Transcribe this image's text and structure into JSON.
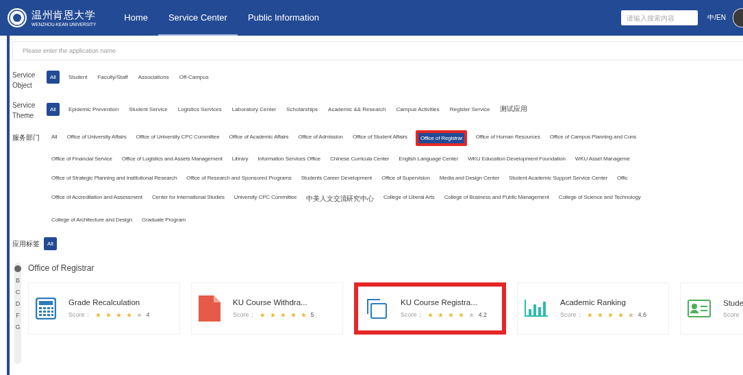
{
  "header": {
    "logo_name": "温州肯恩大学",
    "logo_subtitle": "WENZHOU-KEAN UNIVERSITY",
    "nav": [
      {
        "label": "Home",
        "selected": false
      },
      {
        "label": "Service Center",
        "selected": true
      },
      {
        "label": "Public Information",
        "selected": false
      }
    ],
    "search": {
      "placeholder": "请输入搜索内容"
    },
    "language": "中/EN"
  },
  "app_search": {
    "placeholder": "Please enter the application name"
  },
  "filters": [
    {
      "label": "Service Object",
      "options": [
        {
          "label": "All",
          "selected": true
        },
        {
          "label": "Student",
          "selected": false
        },
        {
          "label": "Faculty/Staff",
          "selected": false
        },
        {
          "label": "Associations",
          "selected": false
        },
        {
          "label": "Off-Campus",
          "selected": false
        }
      ]
    },
    {
      "label": "Service Theme",
      "options": [
        {
          "label": "All",
          "selected": true
        },
        {
          "label": "Epidemic Prevention",
          "selected": false
        },
        {
          "label": "Student Service",
          "selected": false
        },
        {
          "label": "Logistics Services",
          "selected": false
        },
        {
          "label": "Laboratory Center",
          "selected": false
        },
        {
          "label": "Scholarships",
          "selected": false
        },
        {
          "label": "Academic && Research",
          "selected": false
        },
        {
          "label": "Campus Activities",
          "selected": false
        },
        {
          "label": "Register Service",
          "selected": false
        },
        {
          "label": "测试应用",
          "selected": false
        }
      ]
    }
  ],
  "departments": {
    "label": "服务部门",
    "lines": [
      {
        "items": [
          {
            "label": "All",
            "selected": false,
            "highlighted": false
          },
          {
            "label": "Office of University Affairs",
            "selected": false,
            "highlighted": false
          },
          {
            "label": "Office of University CPC Committee",
            "selected": false,
            "highlighted": false
          },
          {
            "label": "Office of Academic Affairs",
            "selected": false,
            "highlighted": false
          },
          {
            "label": "Office of Admission",
            "selected": false,
            "highlighted": false
          },
          {
            "label": "Office of Student Affairs",
            "selected": false,
            "highlighted": false
          },
          {
            "label": "Office of Registrar",
            "selected": true,
            "highlighted": true
          },
          {
            "label": "Office of Human Resources",
            "selected": false,
            "highlighted": false
          },
          {
            "label": "Office of Campus Planning and Cons",
            "selected": false,
            "highlighted": false
          }
        ]
      },
      {
        "items": [
          {
            "label": "Office of Financial Service",
            "selected": false,
            "highlighted": false
          },
          {
            "label": "Office of Logistics and Assets Management",
            "selected": false,
            "highlighted": false
          },
          {
            "label": "Library",
            "selected": false,
            "highlighted": false
          },
          {
            "label": "Information Services Office",
            "selected": false,
            "highlighted": false
          },
          {
            "label": "Chinese Curricula Center",
            "selected": false,
            "highlighted": false
          },
          {
            "label": "English Language Center",
            "selected": false,
            "highlighted": false
          },
          {
            "label": "WKU Education Development Foundation",
            "selected": false,
            "highlighted": false
          },
          {
            "label": "WKU Asset Manageme",
            "selected": false,
            "highlighted": false
          }
        ]
      },
      {
        "items": [
          {
            "label": "Office of Strategic Planning and Institutional Research",
            "selected": false,
            "highlighted": false
          },
          {
            "label": "Office of Research and Sponsored Programs",
            "selected": false,
            "highlighted": false
          },
          {
            "label": "Students Career Development",
            "selected": false,
            "highlighted": false
          },
          {
            "label": "Office of Supervision",
            "selected": false,
            "highlighted": false
          },
          {
            "label": "Media and Design Center",
            "selected": false,
            "highlighted": false
          },
          {
            "label": "Student Academic Support Service Center",
            "selected": false,
            "highlighted": false
          },
          {
            "label": "Offic",
            "selected": false,
            "highlighted": false
          }
        ]
      },
      {
        "items": [
          {
            "label": "Office of Accreditation and Assessment",
            "selected": false,
            "highlighted": false
          },
          {
            "label": "Center for International Studies",
            "selected": false,
            "highlighted": false
          },
          {
            "label": "University CPC Committee",
            "selected": false,
            "highlighted": false
          },
          {
            "label": "中美人文交流研究中心",
            "selected": false,
            "highlighted": false
          },
          {
            "label": "College of Liberal Arts",
            "selected": false,
            "highlighted": false
          },
          {
            "label": "College of Business and Public Management",
            "selected": false,
            "highlighted": false
          },
          {
            "label": "College of Science and Technology",
            "selected": false,
            "highlighted": false
          }
        ]
      },
      {
        "items": [
          {
            "label": "College of Architecture and Design",
            "selected": false,
            "highlighted": false
          },
          {
            "label": "Graduate Program",
            "selected": false,
            "highlighted": false
          }
        ]
      }
    ]
  },
  "tags": {
    "label": "应用标签",
    "options": [
      {
        "label": "All",
        "selected": true
      }
    ]
  },
  "index": [
    "B",
    "C",
    "D",
    "F",
    "G"
  ],
  "section_title": "Office of Registrar",
  "cards": [
    {
      "kind": "calculator",
      "title": "Grade Recalculation",
      "score_label": "Score：",
      "stars": 4,
      "rating": "4",
      "highlighted": false
    },
    {
      "kind": "document",
      "title": "KU Course Withdra...",
      "score_label": "Score：",
      "stars": 5,
      "rating": "5",
      "highlighted": false
    },
    {
      "kind": "copy",
      "title": "KU Course Registra...",
      "score_label": "Score：",
      "stars": 4,
      "rating": "4.2",
      "highlighted": true
    },
    {
      "kind": "chart",
      "title": "Academic Ranking",
      "score_label": "Score：",
      "stars": 4.5,
      "rating": "4.6",
      "highlighted": false
    },
    {
      "kind": "card",
      "title": "Stude",
      "score_label": "Score",
      "highlighted": false
    }
  ]
}
